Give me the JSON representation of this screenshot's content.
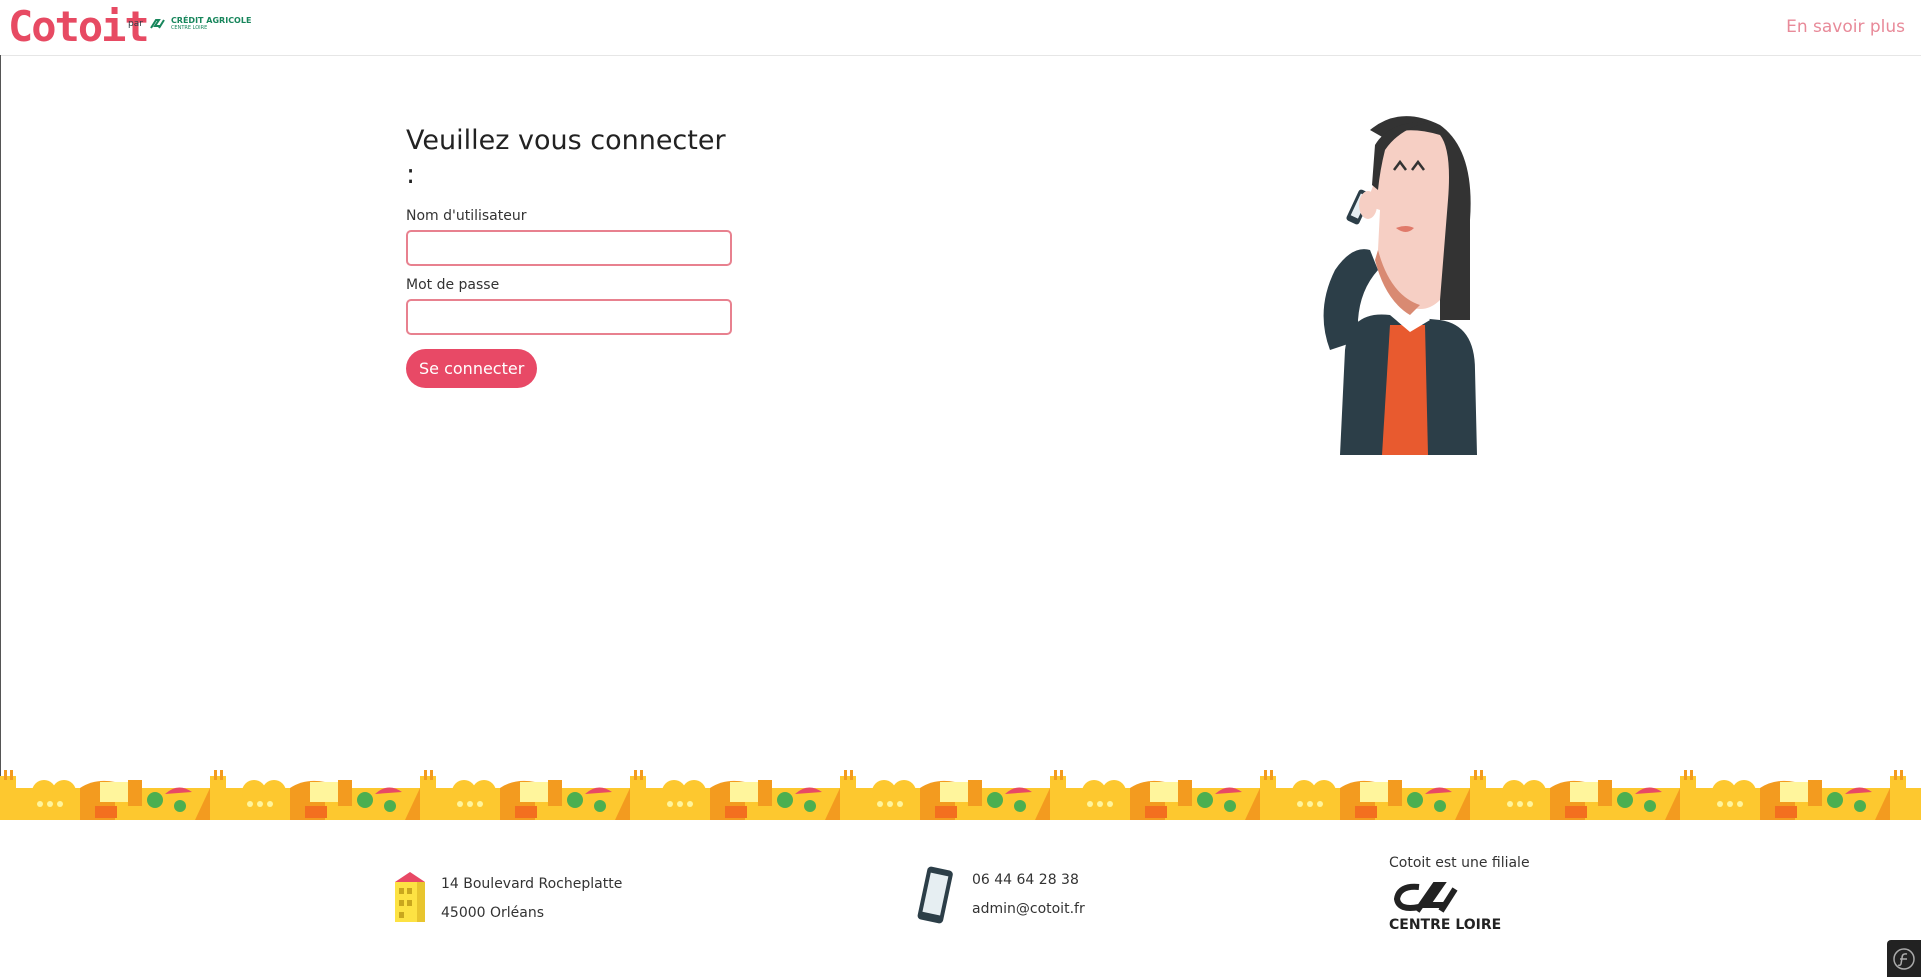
{
  "header": {
    "logo_text": "Cotoit",
    "par": "par",
    "partner_name": "CRÉDIT AGRICOLE",
    "partner_sub": "CENTRE LOIRE",
    "more_link": "En savoir plus"
  },
  "login": {
    "title": "Veuillez vous connecter :",
    "username_label": "Nom d'utilisateur",
    "username_value": "",
    "password_label": "Mot de passe",
    "password_value": "",
    "submit_label": "Se connecter"
  },
  "footer": {
    "address_line1": "14 Boulevard Rocheplatte",
    "address_line2": "45000 Orléans",
    "phone": "06 44 64 28 38",
    "email": "admin@cotoit.fr",
    "filiale_text": "Cotoit est une filiale",
    "ca_name": "CENTRE LOIRE"
  },
  "colors": {
    "brand": "#e74a63",
    "link": "#e88a99",
    "town_yellow": "#fdc82f",
    "ca_green": "#18865c"
  },
  "icons": {
    "building": "building-icon",
    "phone": "smartphone-icon",
    "debug": "symfony-icon"
  }
}
